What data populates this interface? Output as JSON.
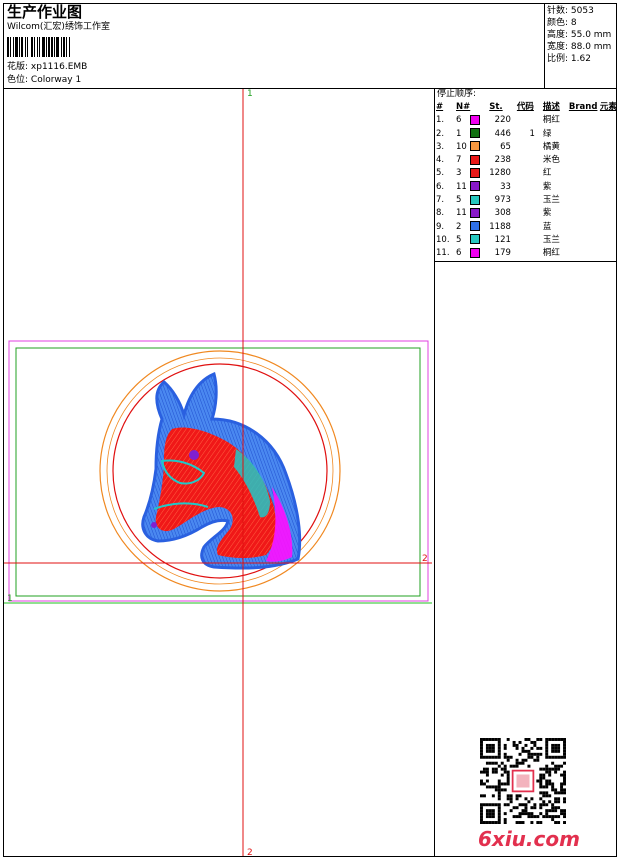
{
  "header": {
    "title": "生产作业图",
    "studio": "Wilcom(汇宏)绣饰工作室",
    "design_label": "花版:",
    "design_value": "xp1116.EMB",
    "colorway_label": "色位:",
    "colorway_value": "Colorway 1"
  },
  "stats": {
    "stitches": "针数: 5053",
    "colors": "颜色: 8",
    "height": "高度: 55.0 mm",
    "width": "宽度: 88.0 mm",
    "scale": "比例: 1.62"
  },
  "stop_sequence": {
    "title": "停止顺序:",
    "headers": {
      "index": "#",
      "needle": "N#",
      "stitches": "St.",
      "code": "代码",
      "description": "描述",
      "brand": "Brand",
      "element": "元素"
    },
    "rows": [
      {
        "index": "1.",
        "needle": "6",
        "color": "#f000f0",
        "stitches": "220",
        "code": "",
        "description": "桐红"
      },
      {
        "index": "2.",
        "needle": "1",
        "color": "#107010",
        "stitches": "446",
        "code": "1",
        "description": "绿"
      },
      {
        "index": "3.",
        "needle": "10",
        "color": "#f89840",
        "stitches": "65",
        "code": "",
        "description": "橘黄"
      },
      {
        "index": "4.",
        "needle": "7",
        "color": "#e81818",
        "stitches": "238",
        "code": "",
        "description": "米色"
      },
      {
        "index": "5.",
        "needle": "3",
        "color": "#e81818",
        "stitches": "1280",
        "code": "",
        "description": "红"
      },
      {
        "index": "6.",
        "needle": "11",
        "color": "#8818c8",
        "stitches": "33",
        "code": "",
        "description": "紫"
      },
      {
        "index": "7.",
        "needle": "5",
        "color": "#28c8c0",
        "stitches": "973",
        "code": "",
        "description": "玉兰"
      },
      {
        "index": "8.",
        "needle": "11",
        "color": "#8818c8",
        "stitches": "308",
        "code": "",
        "description": "紫"
      },
      {
        "index": "9.",
        "needle": "2",
        "color": "#3070e8",
        "stitches": "1188",
        "code": "",
        "description": "蓝"
      },
      {
        "index": "10.",
        "needle": "5",
        "color": "#28c8c0",
        "stitches": "121",
        "code": "",
        "description": "玉兰"
      },
      {
        "index": "11.",
        "needle": "6",
        "color": "#f000f0",
        "stitches": "179",
        "code": "",
        "description": "桐红"
      }
    ]
  },
  "canvas": {
    "vertical_axis_label_top": "1",
    "vertical_axis_label_bottom": "2",
    "horizontal_axis_label_right": "2",
    "horizontal_axis_label_left": "1"
  },
  "watermark": {
    "text": "6xiu.com"
  },
  "colors": {
    "guide_red": "#e01010",
    "outline_magenta": "#e040e0",
    "hoop_green": "#20a020",
    "orange_ring": "#f08820",
    "fill_blue": "#4080f0",
    "fill_red": "#f01818",
    "fill_teal": "#20c8c8",
    "fill_purple": "#8020d0",
    "fill_magenta": "#ff10ff"
  }
}
